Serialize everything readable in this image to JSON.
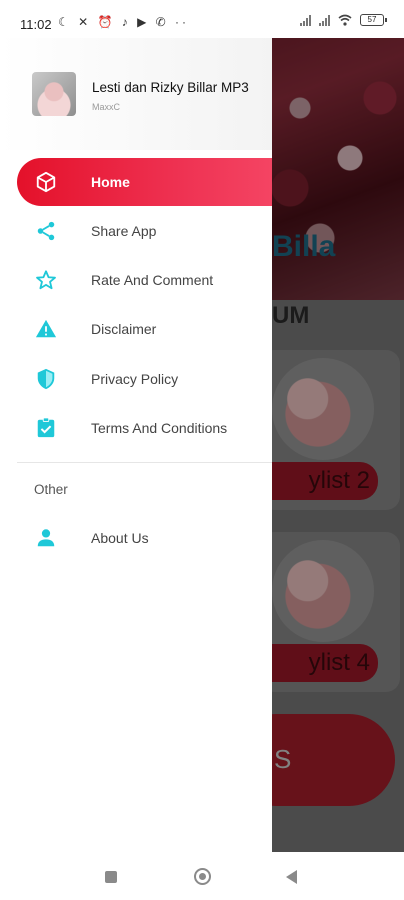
{
  "status_bar": {
    "time": "11:02",
    "left_icons": [
      "moon-icon",
      "no-cell-icon",
      "alarm-icon",
      "tiktok-icon",
      "youtube-icon",
      "whatsapp-icon",
      "more-dots-icon"
    ],
    "left_glyphs": "☾ ✕ ⏰ ♪ ▶ ✆ ··",
    "battery_level": "57"
  },
  "drawer": {
    "app_name": "Lesti dan Rizky Billar MP3",
    "app_subtitle": "MaxxC",
    "menu": [
      {
        "label": "Home",
        "icon": "cube-icon",
        "active": true
      },
      {
        "label": "Share App",
        "icon": "share-icon",
        "active": false
      },
      {
        "label": "Rate And Comment",
        "icon": "star-icon",
        "active": false
      },
      {
        "label": "Disclaimer",
        "icon": "warning-icon",
        "active": false
      },
      {
        "label": "Privacy Policy",
        "icon": "shield-icon",
        "active": false
      },
      {
        "label": "Terms And Conditions",
        "icon": "clipboard-check-icon",
        "active": false
      }
    ],
    "section_other": "Other",
    "other_items": [
      {
        "label": "About Us",
        "icon": "person-icon"
      }
    ]
  },
  "background_app": {
    "hero_title_partial": "Billa",
    "section_title_partial": "UM",
    "cards": [
      {
        "label_partial": "ylist 2"
      },
      {
        "label_partial": "ylist 4"
      }
    ],
    "pill_label_partial": "S"
  },
  "colors": {
    "accent_red": "#e4112a",
    "icon_cyan": "#1fc8d8",
    "scrim": "#000000"
  }
}
